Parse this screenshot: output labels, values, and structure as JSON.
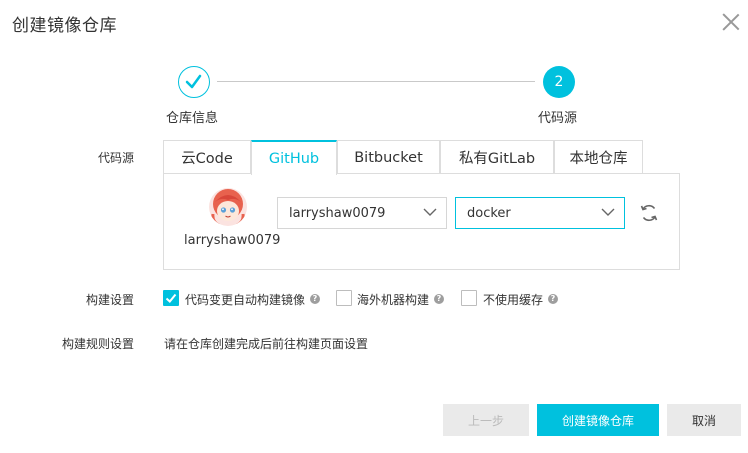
{
  "dialog": {
    "title": "创建镜像仓库"
  },
  "steps": [
    {
      "label": "仓库信息",
      "status": "done",
      "icon": "check-icon"
    },
    {
      "label": "代码源",
      "number": "2",
      "status": "active"
    }
  ],
  "source": {
    "label": "代码源",
    "tabs": [
      {
        "label": "云Code",
        "active": false
      },
      {
        "label": "GitHub",
        "active": true
      },
      {
        "label": "Bitbucket",
        "active": false
      },
      {
        "label": "私有GitLab",
        "active": false
      },
      {
        "label": "本地仓库",
        "active": false
      }
    ],
    "account_name": "larryshaw0079",
    "namespace_select": "larryshaw0079",
    "repo_select": "docker",
    "refresh_icon": "refresh-icon"
  },
  "build_settings": {
    "label": "构建设置",
    "options": [
      {
        "label": "代码变更自动构建镜像",
        "checked": true,
        "help": "?"
      },
      {
        "label": "海外机器构建",
        "checked": false,
        "help": "?"
      },
      {
        "label": "不使用缓存",
        "checked": false,
        "help": "?"
      }
    ]
  },
  "build_rules": {
    "label": "构建规则设置",
    "text": "请在仓库创建完成后前往构建页面设置"
  },
  "footer": {
    "prev_label": "上一步",
    "create_label": "创建镜像仓库",
    "cancel_label": "取消"
  },
  "colors": {
    "accent": "#00c1de",
    "border": "#dddddd",
    "button_gray": "#eaeaea",
    "help_icon": "#9e9e9e"
  }
}
